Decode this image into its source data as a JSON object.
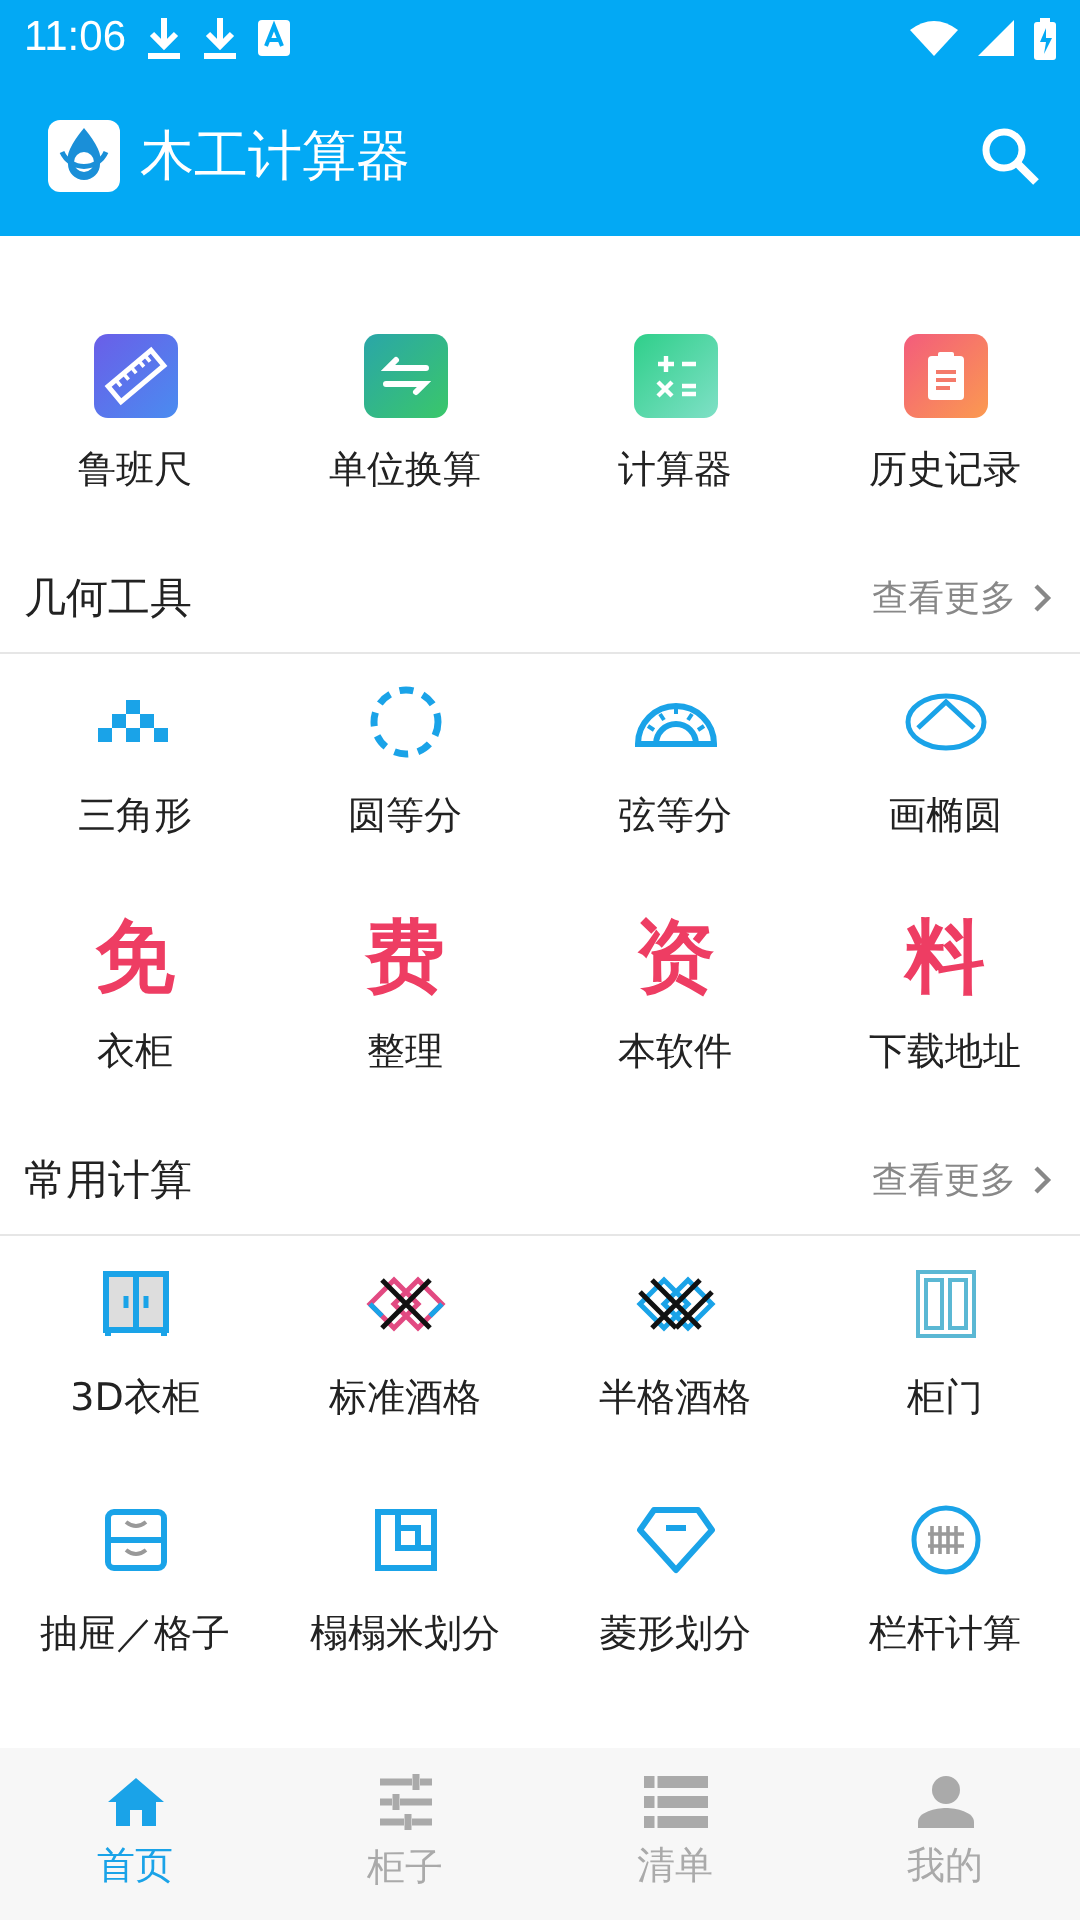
{
  "status_bar": {
    "time": "11:06"
  },
  "app_bar": {
    "title": "木工计算器"
  },
  "sections": [
    {
      "items": [
        {
          "kind": "ruler",
          "label": "鲁班尺"
        },
        {
          "kind": "convert",
          "label": "单位换算"
        },
        {
          "kind": "calculator",
          "label": "计算器"
        },
        {
          "kind": "clipboard",
          "label": "历史记录"
        }
      ]
    },
    {
      "title": "几何工具",
      "more": "查看更多",
      "items": [
        {
          "kind": "triangle",
          "label": "三角形"
        },
        {
          "kind": "circle",
          "label": "圆等分"
        },
        {
          "kind": "protractor",
          "label": "弦等分"
        },
        {
          "kind": "ellipse",
          "label": "画椭圆"
        },
        {
          "kind": "glyph",
          "glyph": "免",
          "label": "衣柜"
        },
        {
          "kind": "glyph",
          "glyph": "费",
          "label": "整理"
        },
        {
          "kind": "glyph",
          "glyph": "资",
          "label": "本软件"
        },
        {
          "kind": "glyph",
          "glyph": "料",
          "label": "下载地址"
        }
      ]
    },
    {
      "title": "常用计算",
      "more": "查看更多",
      "items": [
        {
          "kind": "wardrobe",
          "label": "3D衣柜"
        },
        {
          "kind": "lattice",
          "label": "标准酒格"
        },
        {
          "kind": "lattice-half",
          "label": "半格酒格"
        },
        {
          "kind": "door",
          "label": "柜门"
        },
        {
          "kind": "drawer",
          "label": "抽屉／格子"
        },
        {
          "kind": "tatami",
          "label": "榻榻米划分"
        },
        {
          "kind": "diamond",
          "label": "菱形划分"
        },
        {
          "kind": "railing",
          "label": "栏杆计算"
        }
      ]
    }
  ],
  "tabs": [
    {
      "label": "首页",
      "kind": "home",
      "selected": true
    },
    {
      "label": "柜子",
      "kind": "sliders",
      "selected": false
    },
    {
      "label": "清单",
      "kind": "list",
      "selected": false
    },
    {
      "label": "我的",
      "kind": "person",
      "selected": false
    }
  ]
}
